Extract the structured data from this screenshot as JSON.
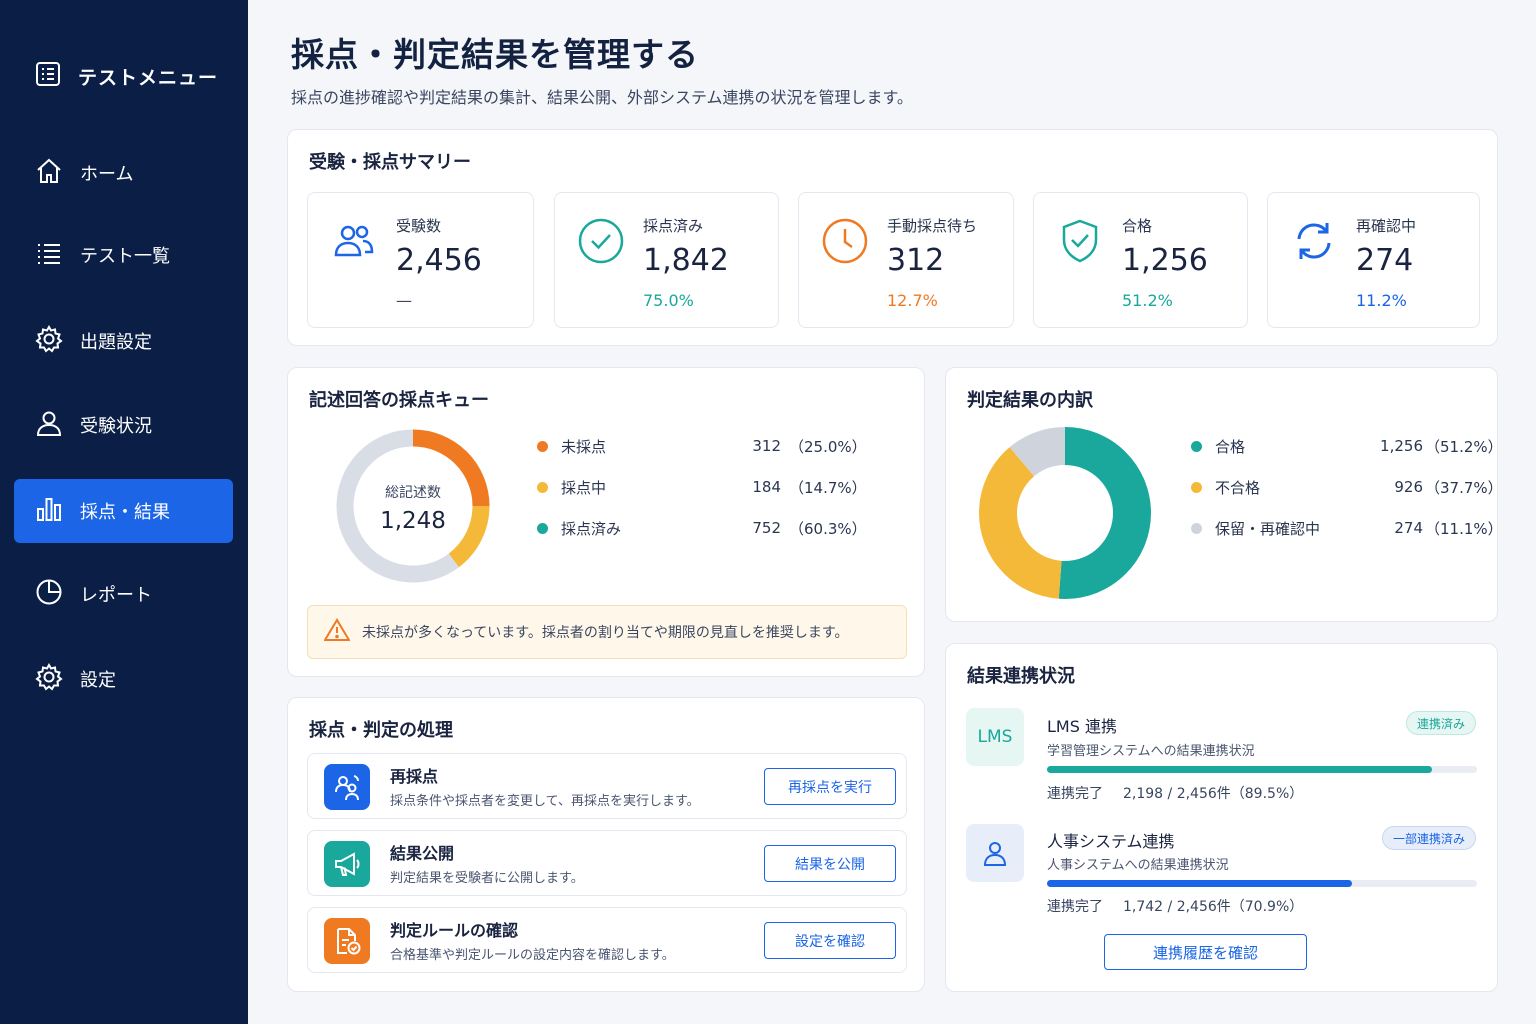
{
  "sidebar": {
    "header": "テストメニュー",
    "items": [
      {
        "label": "ホーム"
      },
      {
        "label": "テスト一覧"
      },
      {
        "label": "出題設定"
      },
      {
        "label": "受験状況"
      },
      {
        "label": "採点・結果"
      },
      {
        "label": "レポート"
      },
      {
        "label": "設定"
      }
    ],
    "active_index": 4
  },
  "page": {
    "title": "採点・判定結果を管理する",
    "subtitle": "採点の進捗確認や判定結果の集計、結果公開、外部システム連携の状況を管理します。"
  },
  "summary": {
    "title": "受験・採点サマリー",
    "stats": [
      {
        "label": "受験数",
        "value": "2,456",
        "pct": "—",
        "color": "#1b65e6",
        "icon": "users-icon"
      },
      {
        "label": "採点済み",
        "value": "1,842",
        "pct": "75.0%",
        "color": "#1aa89c",
        "icon": "check-circle-icon"
      },
      {
        "label": "手動採点待ち",
        "value": "312",
        "pct": "12.7%",
        "color": "#ef7a22",
        "icon": "clock-icon"
      },
      {
        "label": "合格",
        "value": "1,256",
        "pct": "51.2%",
        "color": "#1aa89c",
        "icon": "shield-check-icon"
      },
      {
        "label": "再確認中",
        "value": "274",
        "pct": "11.2%",
        "color": "#1b65e6",
        "icon": "refresh-icon"
      }
    ]
  },
  "queue": {
    "title": "記述回答の採点キュー",
    "center_label": "総記述数",
    "center_value": "1,248",
    "items": [
      {
        "label": "未採点",
        "value": 312,
        "value_text": "312",
        "pct": "（25.0%）",
        "color": "#ef7a22"
      },
      {
        "label": "採点中",
        "value": 184,
        "value_text": "184",
        "pct": "（14.7%）",
        "color": "#f5b93a"
      },
      {
        "label": "採点済み",
        "value": 752,
        "value_text": "752",
        "pct": "（60.3%）",
        "color": "#d9dde5"
      }
    ],
    "legend_dot_colors": [
      "#ef7a22",
      "#f5b93a",
      "#1aa89c"
    ],
    "alert": "未採点が多くなっています。採点者の割り当てや期限の見直しを推奨します。"
  },
  "breakdown": {
    "title": "判定結果の内訳",
    "items": [
      {
        "label": "合格",
        "value": 1256,
        "value_text": "1,256",
        "pct": "（51.2%）",
        "color": "#1aa89c"
      },
      {
        "label": "不合格",
        "value": 926,
        "value_text": "926",
        "pct": "（37.7%）",
        "color": "#f5b93a"
      },
      {
        "label": "保留・再確認中",
        "value": 274,
        "value_text": "274",
        "pct": "（11.1%）",
        "color": "#cfd4dc"
      }
    ]
  },
  "actions": {
    "title": "採点・判定の処理",
    "items": [
      {
        "title": "再採点",
        "desc": "採点条件や採点者を変更して、再採点を実行します。",
        "button": "再採点を実行",
        "color": "#1b65e6",
        "icon": "rescore-users-icon"
      },
      {
        "title": "結果公開",
        "desc": "判定結果を受験者に公開します。",
        "button": "結果を公開",
        "color": "#1aa89c",
        "icon": "megaphone-icon"
      },
      {
        "title": "判定ルールの確認",
        "desc": "合格基準や判定ルールの設定内容を確認します。",
        "button": "設定を確認",
        "color": "#ef7a22",
        "icon": "document-check-icon"
      }
    ]
  },
  "integration": {
    "title": "結果連携状況",
    "items": [
      {
        "icon_text": "LMS",
        "title": "LMS 連携",
        "desc": "学習管理システムへの結果連携状況",
        "badge": "連携済み",
        "progress": 0.895,
        "stat_label": "連携完了",
        "stat_value": "2,198 / 2,456件（89.5%）",
        "color": "#1aa89c"
      },
      {
        "icon_text": "",
        "title": "人事システム連携",
        "desc": "人事システムへの結果連携状況",
        "badge": "一部連携済み",
        "progress": 0.709,
        "stat_label": "連携完了",
        "stat_value": "1,742 / 2,456件（70.9%）",
        "color": "#1b65e6"
      }
    ],
    "history_button": "連携履歴を確認"
  }
}
